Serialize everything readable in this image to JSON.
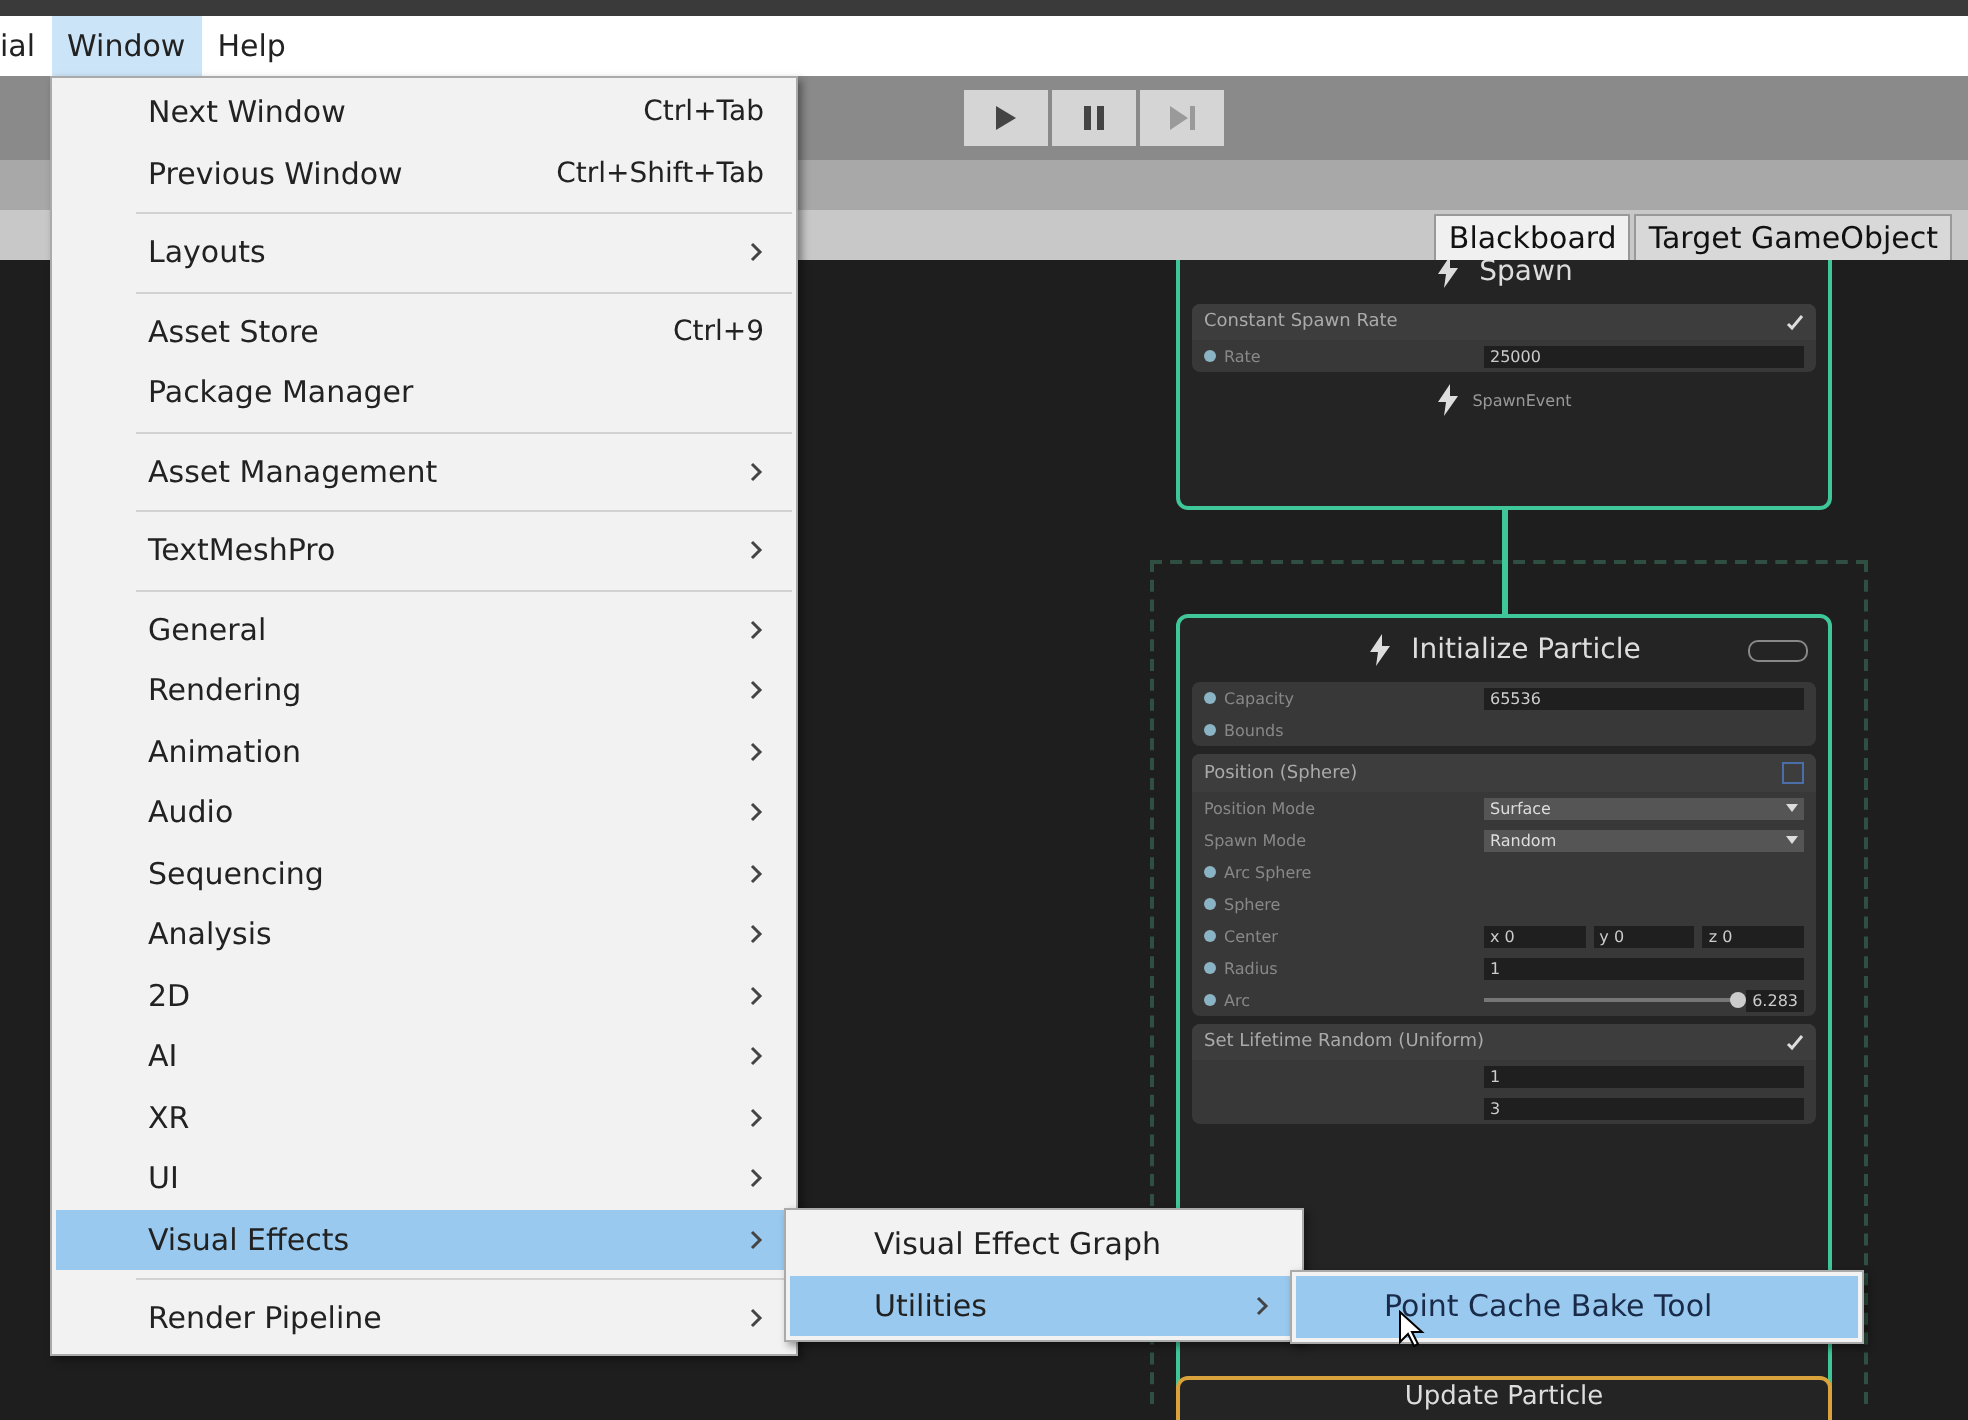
{
  "menubar": [
    {
      "label": "ial",
      "selected": false
    },
    {
      "label": "Window",
      "selected": true
    },
    {
      "label": "Help",
      "selected": false
    }
  ],
  "playback": [
    {
      "kind": "play",
      "disabled": false
    },
    {
      "kind": "pause",
      "disabled": false
    },
    {
      "kind": "step",
      "disabled": true
    }
  ],
  "tabs": [
    {
      "label": "Blackboard",
      "selected": true
    },
    {
      "label": "Target GameObject",
      "selected": false
    }
  ],
  "window_menu": [
    [
      {
        "label": "Next Window",
        "shortcut": "Ctrl+Tab",
        "selected": false
      },
      {
        "label": "Previous Window",
        "shortcut": "Ctrl+Shift+Tab",
        "selected": false
      }
    ],
    [
      {
        "label": "Layouts",
        "submenu": true,
        "selected": false
      }
    ],
    [
      {
        "label": "Asset Store",
        "shortcut": "Ctrl+9",
        "selected": false
      },
      {
        "label": "Package Manager",
        "selected": false
      }
    ],
    [
      {
        "label": "Asset Management",
        "submenu": true,
        "selected": false
      }
    ],
    [
      {
        "label": "TextMeshPro",
        "submenu": true,
        "selected": false
      }
    ],
    [
      {
        "label": "General",
        "submenu": true,
        "selected": false
      },
      {
        "label": "Rendering",
        "submenu": true,
        "selected": false
      },
      {
        "label": "Animation",
        "submenu": true,
        "selected": false
      },
      {
        "label": "Audio",
        "submenu": true,
        "selected": false
      },
      {
        "label": "Sequencing",
        "submenu": true,
        "selected": false
      },
      {
        "label": "Analysis",
        "submenu": true,
        "selected": false
      },
      {
        "label": "2D",
        "submenu": true,
        "selected": false
      },
      {
        "label": "AI",
        "submenu": true,
        "selected": false
      },
      {
        "label": "XR",
        "submenu": true,
        "selected": false
      },
      {
        "label": "UI",
        "submenu": true,
        "selected": false
      },
      {
        "label": "Visual Effects",
        "submenu": true,
        "selected": true
      }
    ],
    [
      {
        "label": "Render Pipeline",
        "submenu": true,
        "selected": false
      }
    ]
  ],
  "visual_effects_menu": [
    {
      "label": "Visual Effect Graph",
      "selected": false
    },
    {
      "label": "Utilities",
      "submenu": true,
      "selected": true
    }
  ],
  "utilities_menu": [
    {
      "label": "Point Cache Bake Tool",
      "selected": true
    }
  ],
  "graph": {
    "spawn": {
      "title": "Spawn",
      "color": "#3fc79a",
      "blocks": [
        {
          "title": "Constant Spawn Rate",
          "enabled": true,
          "rows": [
            {
              "kind": "field",
              "label": "Rate",
              "value": "25000"
            }
          ]
        }
      ],
      "footer": "SpawnEvent"
    },
    "initialize": {
      "title": "Initialize Particle",
      "color": "#3fc79a",
      "rows": [
        {
          "kind": "field",
          "label": "Capacity",
          "value": "65536"
        },
        {
          "kind": "port",
          "label": "Bounds"
        }
      ],
      "blocks": [
        {
          "title": "Position (Sphere)",
          "enabled": false,
          "rows": [
            {
              "kind": "dropdown",
              "label": "Position Mode",
              "value": "Surface"
            },
            {
              "kind": "dropdown",
              "label": "Spawn Mode",
              "value": "Random"
            },
            {
              "kind": "port",
              "label": "Arc Sphere"
            },
            {
              "kind": "port",
              "label": "Sphere"
            },
            {
              "kind": "vector",
              "label": "Center",
              "values": [
                "x",
                "0",
                "y",
                "0",
                "z",
                "0"
              ]
            },
            {
              "kind": "field",
              "label": "Radius",
              "value": "1"
            },
            {
              "kind": "slider",
              "label": "Arc",
              "value": "6.283",
              "level": 1
            }
          ]
        },
        {
          "title": "Set Lifetime Random (Uniform)",
          "enabled": true,
          "rows": [
            {
              "kind": "field",
              "value": "1"
            },
            {
              "kind": "field",
              "value": "3"
            }
          ]
        }
      ]
    },
    "update": {
      "title": "Update Particle",
      "color": "#d9a23a"
    }
  }
}
